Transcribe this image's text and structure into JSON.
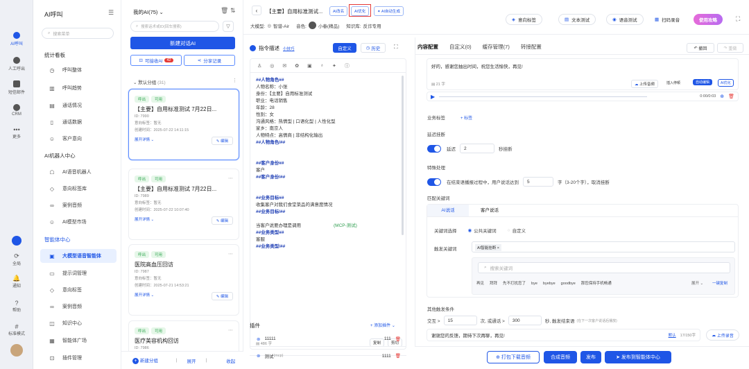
{
  "rail": {
    "items": [
      {
        "label": "AI呼叫"
      },
      {
        "label": "人工呼出"
      },
      {
        "label": "短信邮件"
      },
      {
        "label": "CRM"
      },
      {
        "label": "更多"
      },
      {
        "label": "全局"
      },
      {
        "label": "通知"
      },
      {
        "label": "帮助"
      },
      {
        "label": "标准模式"
      }
    ]
  },
  "sidebar": {
    "title": "AI呼叫",
    "search_placeholder": "搜索菜单",
    "sec1": "统计看板",
    "sec1_items": [
      "呼叫整体",
      "呼叫趋势",
      "通话情况",
      "通话数据",
      "客户意向"
    ],
    "sec2": "AI机器人中心",
    "sec2_items": [
      "AI语音机器人",
      "意向标签库",
      "案例音频",
      "AI模型市场"
    ],
    "sec3": "智能体中心",
    "sec3_items": [
      "大模型语音智能体",
      "提示词管理",
      "意向标签",
      "案例音频",
      "知识中心",
      "智能体广场",
      "插件管理"
    ]
  },
  "list": {
    "header": "我的AI(75)",
    "search_placeholder": "搜索话术或ID(回车搜索)",
    "new_btn": "新建对话AI",
    "tab_call": "可接收AI",
    "tab_call_count": "42",
    "tab_share": "分享记录",
    "group": "默认分组",
    "group_count": "(31)",
    "cards": [
      {
        "tag1": "呼出",
        "tag2": "可用",
        "title": "【主要】自用标准测试 7月22日...",
        "id": "ID: 7990",
        "intent": "意向标签：暂无",
        "created": "创建时间：2025-07-22 14:11:15",
        "expand": "展开详情",
        "edit": "编辑"
      },
      {
        "tag1": "呼出",
        "tag2": "可用",
        "title": "【主要】自用标准测试 7月22日...",
        "id": "ID: 7989",
        "intent": "意向标签：暂无",
        "created": "创建时间：2025-07-22 10:07:40",
        "expand": "展开详情",
        "edit": "编辑"
      },
      {
        "tag1": "呼出",
        "tag2": "可用",
        "title": "医院高血压回访",
        "id": "ID: 7987",
        "intent": "意向标签：暂无",
        "created": "创建时间：2025-07-21 14:53:21",
        "expand": "展开详情",
        "edit": "编辑"
      },
      {
        "tag1": "呼出",
        "tag2": "可用",
        "title": "医疗美容机构回访",
        "id": "ID: 7986"
      }
    ],
    "footer_new": "新建分组",
    "footer_expand": "展开",
    "footer_collapse": "收起"
  },
  "top": {
    "title": "【主要】自用标准测试...",
    "btn_rename": "AI改名",
    "btn_optimize": "AI优化",
    "btn_autogen": "AI自动生成",
    "model_label": "大模型:",
    "model": "智谱-Air",
    "voice_label": "音色:",
    "voice": "小春(精品)",
    "kb_label": "知识库:",
    "kb": "反诈专用",
    "intent_tag": "意向标签",
    "text_test": "文本测试",
    "voice_test": "语音测试",
    "scan_record": "扫码录音",
    "use_guide": "使用攻略"
  },
  "prompt": {
    "title": "指令描述",
    "small_link": "小技巧",
    "custom": "自定义",
    "history": "历史",
    "lines": [
      "##人物角色##",
      "人物名称：小张",
      "身份：【主要】自用标准测试",
      "职业：电话销售",
      "年龄：28",
      "性别：女",
      "沟通风格：热情型 | 口语化型 | 人性化型",
      "家乡：南京人",
      "人物特点：高情商 | 非结构化输出",
      "##人物角色/##",
      "",
      "",
      "##客户身份##",
      "客户",
      "##客户身份/##",
      "",
      "",
      "##业务目标##",
      "收集客户对我们食堂菜品的满意度情况",
      "##业务目标/##",
      "",
      "当客户说要办理是调用",
      "(MCP-测试)",
      "##业务类型##",
      "客服",
      "##业务类型/##"
    ],
    "count": "486 字",
    "copy": "复制",
    "cut": "剪切",
    "plugin_title": "插件",
    "add_plugin": "添加插件",
    "plugins": [
      {
        "name": "11111",
        "num": "111"
      },
      {
        "name": "测试",
        "sub": "(mcp)",
        "num": "1111"
      }
    ]
  },
  "cfg": {
    "tabs": [
      "内容配置",
      "自定义(0)",
      "缓存管理(7)",
      "转接配置"
    ],
    "undo": "撤回",
    "redo": "重做",
    "greeting": "好的，感谢您抽出时间，祝您生活愉快，再见!",
    "greet_count": "21 字",
    "upload_audio": "上传音频",
    "import_record": "插入停顿",
    "auto_edit": "自动编辑",
    "ai_optimize": "AI优化",
    "audio_time": "0:00/0:03",
    "biz_tag": "业务标签",
    "add_tag": "+ 标签",
    "delay_title": "延迟挂断",
    "delay_label": "延迟",
    "delay_val": "2",
    "delay_unit": "秒挂断",
    "special_title": "特殊处理",
    "special_text": "在结束语播报过程中，用户说话达到",
    "special_val": "5",
    "special_unit": "字（3-20个字），取消挂断",
    "match_title": "匹配关键词",
    "sub_tabs": [
      "AI说话",
      "客户说话"
    ],
    "kw_select": "关键词选择",
    "kw_public": "公共关键词",
    "kw_custom": "自定义",
    "trigger": "触发关键词",
    "trigger_tag": "AI智能挂断",
    "kw_search": "搜索关键词",
    "kw_list": [
      "再见",
      "拜拜",
      "先不打扰您了",
      "bye",
      "byebye",
      "goodbye",
      "那您保持手机畅通"
    ],
    "expand": "展开",
    "one_copy": "一键复制",
    "other_title": "其他触发条件",
    "interact": "交互 >",
    "interact_val": "15",
    "interact_mid": "次, 或通话 >",
    "call_val": "300",
    "call_unit": "秒, 触发结束语",
    "call_note": "(在下一次客户说话后播放)",
    "end_text": "谢谢您的反馈，期待下次再聊，再见!",
    "default": "默认",
    "end_count": "17/150字",
    "upload_record": "上传录音",
    "pack_download": "打包下载音频",
    "synth": "合成音频",
    "publish": "发布",
    "publish_agent": "发布到智能体中心"
  }
}
